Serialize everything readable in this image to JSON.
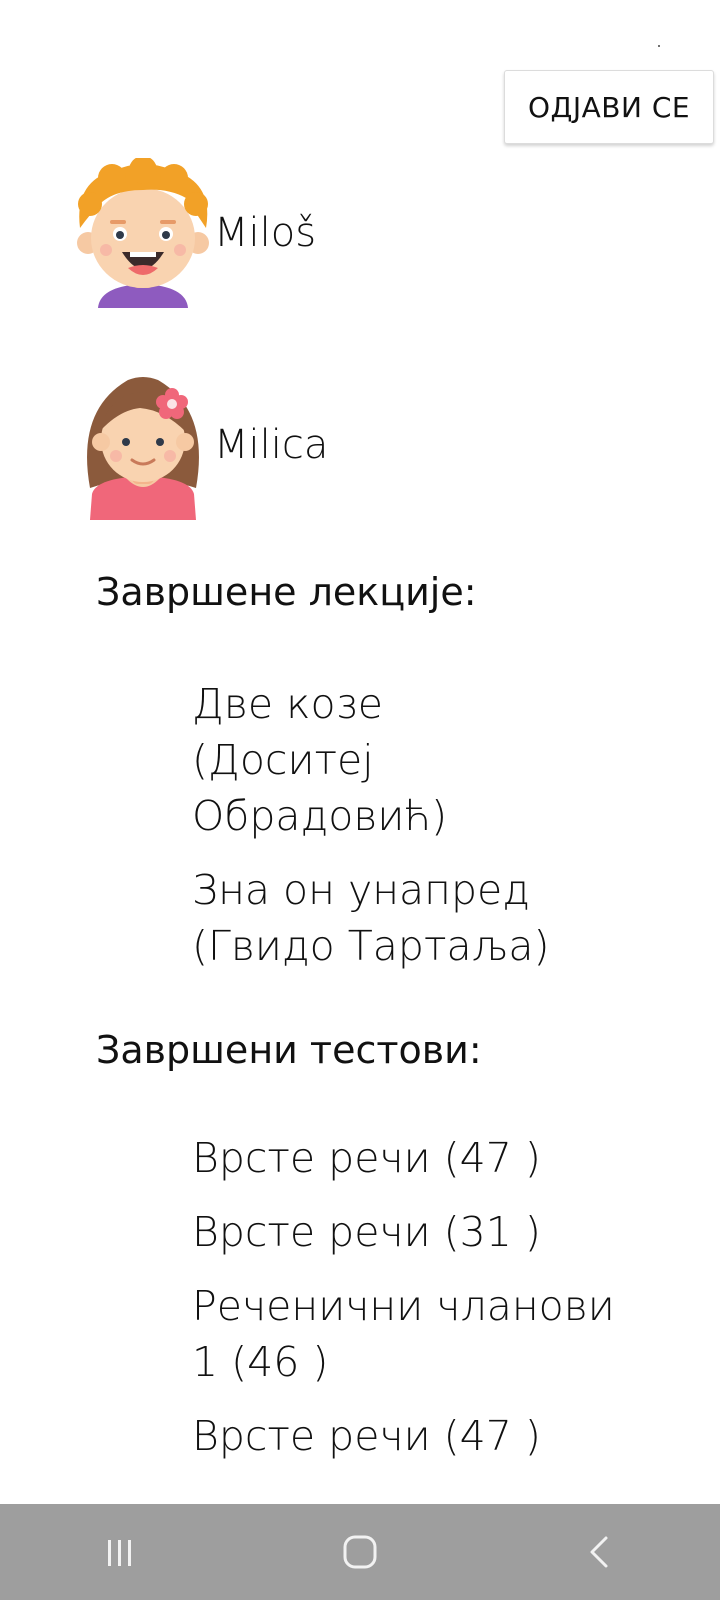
{
  "header": {
    "logout_label": "ОДЈАВИ СЕ"
  },
  "children": [
    {
      "name": "Miloš",
      "avatar": "boy-avatar-icon"
    },
    {
      "name": "Milica",
      "avatar": "girl-avatar-icon"
    }
  ],
  "lessons": {
    "title": "Завршене лекције:",
    "items": [
      "Две козе\n (Доситеј\nОбрадовић)",
      "Зна он унапред\n (Гвидо Тартаља)"
    ]
  },
  "tests": {
    "title": "Завршени тестови:",
    "items": [
      "Врсте речи (47 )",
      "Врсте речи (31 )",
      "Реченични чланови\n1 (46 )",
      "Врсте речи (47 )"
    ]
  },
  "nav": {
    "recents": "recents-icon",
    "home": "home-icon",
    "back": "back-icon",
    "bar_color": "#9e9e9e"
  }
}
